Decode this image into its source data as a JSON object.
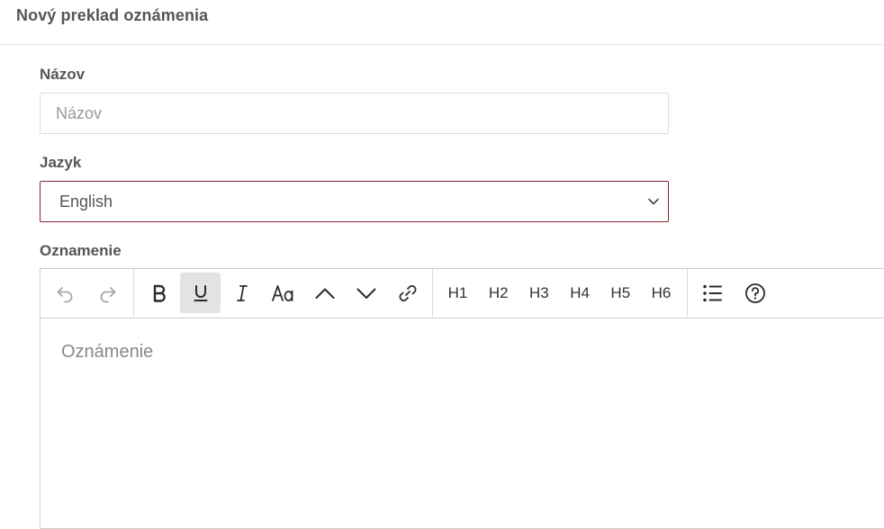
{
  "header": {
    "title": "Nový preklad oznámenia"
  },
  "form": {
    "name_label": "Názov",
    "name_placeholder": "Názov",
    "language_label": "Jazyk",
    "language_value": "English",
    "announcement_label": "Oznamenie",
    "editor_placeholder": "Oznámenie"
  },
  "toolbar": {
    "history": [
      {
        "name": "undo-icon",
        "enabled": false
      },
      {
        "name": "redo-icon",
        "enabled": false
      }
    ],
    "formatting": [
      {
        "name": "bold-icon",
        "active": false
      },
      {
        "name": "underline-icon",
        "active": true
      },
      {
        "name": "italic-icon",
        "active": false
      },
      {
        "name": "text-case-icon",
        "active": false
      },
      {
        "name": "chevron-up-icon",
        "active": false
      },
      {
        "name": "chevron-down-icon",
        "active": false
      },
      {
        "name": "link-icon",
        "active": false
      }
    ],
    "headings": [
      "H1",
      "H2",
      "H3",
      "H4",
      "H5",
      "H6"
    ],
    "extras": [
      {
        "name": "bullet-list-icon"
      },
      {
        "name": "help-icon"
      }
    ]
  },
  "colors": {
    "select_border": "#8a2232",
    "active_button_bg": "#e3e3e3",
    "label_text": "#555555"
  }
}
